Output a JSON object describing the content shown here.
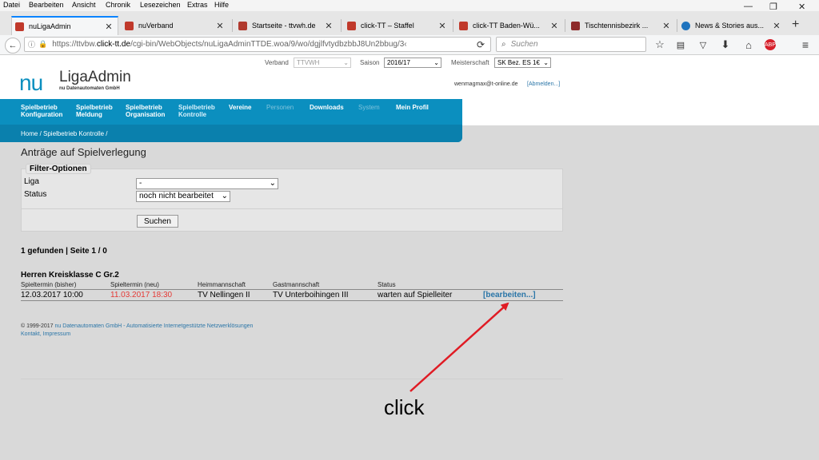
{
  "menubar": [
    "Datei",
    "Bearbeiten",
    "Ansicht",
    "Chronik",
    "Lesezeichen",
    "Extras",
    "Hilfe"
  ],
  "tabs": [
    {
      "title": "nuLigaAdmin",
      "active": true
    },
    {
      "title": "nuVerband"
    },
    {
      "title": "Startseite - ttvwh.de"
    },
    {
      "title": "click-TT – Staffel"
    },
    {
      "title": "click-TT Baden-Wü..."
    },
    {
      "title": "Tischtennisbezirk ..."
    },
    {
      "title": "News & Stories aus..."
    }
  ],
  "new_tab": "+",
  "window_controls": {
    "minimize": "—",
    "restore": "❐",
    "close": "✕"
  },
  "url": {
    "prefix": "https://ttvbw.",
    "domain": "click-tt.de",
    "path": "/cgi-bin/WebObjects/nuLigaAdminTTDE.woa/9/wo/dgjlfvtydbzbbJ8Un2bbug/3‹"
  },
  "search_placeholder": "Suchen",
  "header": {
    "verband_label": "Verband",
    "verband_value": "TTVWH",
    "saison_label": "Saison",
    "saison_value": "2016/17",
    "meisterschaft_label": "Meisterschaft",
    "meisterschaft_value": "SK Bez. ES 1€",
    "logo_nu": "nu",
    "logo_ligaadmin": "LigaAdmin",
    "logo_sub": "nu Datenautomaten GmbH",
    "email": "wenmagmax@t-online.de",
    "logout": "[Abmelden...]"
  },
  "nav": [
    {
      "l1": "Spielbetrieb",
      "l2": "Konfiguration"
    },
    {
      "l1": "Spielbetrieb",
      "l2": "Meldung"
    },
    {
      "l1": "Spielbetrieb",
      "l2": "Organisation"
    },
    {
      "l1": "Spielbetrieb",
      "l2": "Kontrolle"
    },
    {
      "l1": "Vereine",
      "l2": ""
    },
    {
      "l1": "Personen",
      "l2": ""
    },
    {
      "l1": "Downloads",
      "l2": ""
    },
    {
      "l1": "System",
      "l2": ""
    },
    {
      "l1": "Mein Profil",
      "l2": ""
    }
  ],
  "breadcrumb": "Home / Spielbetrieb Kontrolle /",
  "page_title": "Anträge auf Spielverlegung",
  "filter": {
    "legend": "Filter-Optionen",
    "liga_label": "Liga",
    "liga_value": "-",
    "status_label": "Status",
    "status_value": "noch nicht bearbeitet",
    "search_button": "Suchen"
  },
  "results_summary": "1 gefunden | Seite 1 / 0",
  "group_title": "Herren Kreisklasse C Gr.2",
  "table": {
    "headers": [
      "Spieltermin (bisher)",
      "Spieltermin (neu)",
      "Heimmannschaft",
      "Gastmannschaft",
      "Status"
    ],
    "row": {
      "old_date": "12.03.2017 10:00",
      "new_date": "11.03.2017 18:30",
      "home": "TV Nellingen II",
      "guest": "TV Unterboihingen III",
      "status": "warten auf Spielleiter",
      "action": "[bearbeiten...]"
    }
  },
  "footer": {
    "copyright": "© 1999-2017",
    "company": "nu Datenautomaten GmbH - Automatisierte Internetgestützte Netzwerklösungen",
    "links": "Kontakt, Impressum"
  },
  "annotation": "click",
  "colors": {
    "brand_blue": "#0b8fbf",
    "link": "#2b76a8",
    "red": "#e53935",
    "arrow": "#e01b24"
  }
}
